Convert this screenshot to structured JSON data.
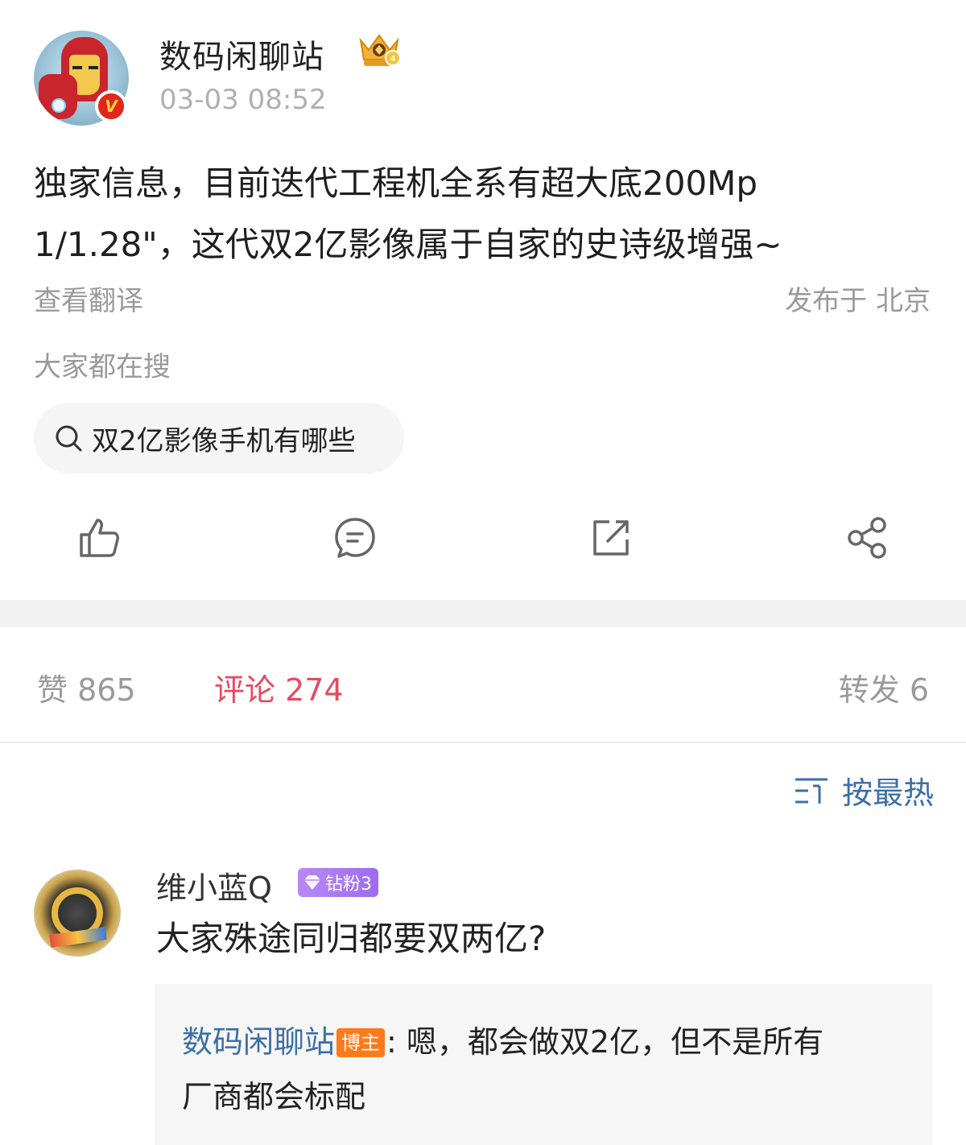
{
  "post": {
    "author": "数码闲聊站",
    "timestamp": "03-03 08:52",
    "verified_mark": "V",
    "text_lines": [
      "独家信息，目前迭代工程机全系有超大底200Mp",
      "1/1.28\"，这代双2亿影像属于自家的史诗级增强~"
    ],
    "translate_label": "查看翻译",
    "location": "发布于 北京",
    "trending_title": "大家都在搜",
    "trending_query": "双2亿影像手机有哪些",
    "icons": [
      "like-icon",
      "comment-icon",
      "repost-icon",
      "share-icon"
    ]
  },
  "stats": {
    "like": "赞 865",
    "comment": "评论 274",
    "repost": "转发 6"
  },
  "sort": {
    "label": "按最热"
  },
  "comment": {
    "author": "维小蓝Q",
    "badge": "钻粉3",
    "text": "大家殊途同归都要双两亿?",
    "reply": {
      "author": "数码闲聊站",
      "badge": "博主",
      "separator": ":",
      "text_line1": " 嗯，都会做双2亿，但不是所有",
      "text_line2": "厂商都会标配"
    }
  },
  "colors": {
    "accent_red": "#e8495e",
    "link_blue": "#3c6fa8",
    "muted_gray": "#9a9a9a",
    "blogger_orange": "#ff7a1a",
    "fan_purple": "#9d6cf0"
  }
}
